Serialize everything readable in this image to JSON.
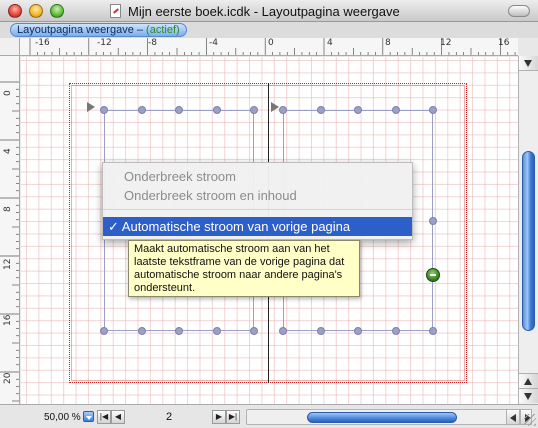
{
  "window": {
    "title": "Mijn eerste boek.icdk - Layoutpagina weergave"
  },
  "tab": {
    "label": "Layoutpagina weergave",
    "separator": " – ",
    "status": "(actief)"
  },
  "ruler_top": {
    "labels": [
      "-16",
      "-12",
      "-8",
      "-4",
      "0",
      "4",
      "8",
      "12",
      "16"
    ]
  },
  "ruler_left": {
    "labels": [
      "0",
      "4",
      "8",
      "12",
      "16",
      "20"
    ]
  },
  "context_menu": {
    "items": [
      {
        "label": "Onderbreek stroom",
        "enabled": false
      },
      {
        "label": "Onderbreek stroom en inhoud",
        "enabled": false
      },
      {
        "label": "✓ Automatische stroom van vorige pagina",
        "enabled": true,
        "selected": true
      }
    ]
  },
  "tooltip": {
    "text": "Maakt automatische stroom aan van het laatste tekstframe van de vorige pagina dat automatische stroom naar andere pagina's ondersteunt."
  },
  "bottom_bar": {
    "zoom": "50,00 %",
    "page_number": "2"
  },
  "colors": {
    "selection": "#2c5fc8",
    "tooltip_bg": "#ffffc8",
    "page_border": "#cc2222",
    "frame": "#9aa0c6",
    "grid": "#e8afaf"
  },
  "icons": [
    "close-icon",
    "minimize-icon",
    "zoom-icon",
    "document-icon",
    "toolbar-toggle-icon",
    "flow-handle-icon",
    "resize-grip-icon"
  ]
}
